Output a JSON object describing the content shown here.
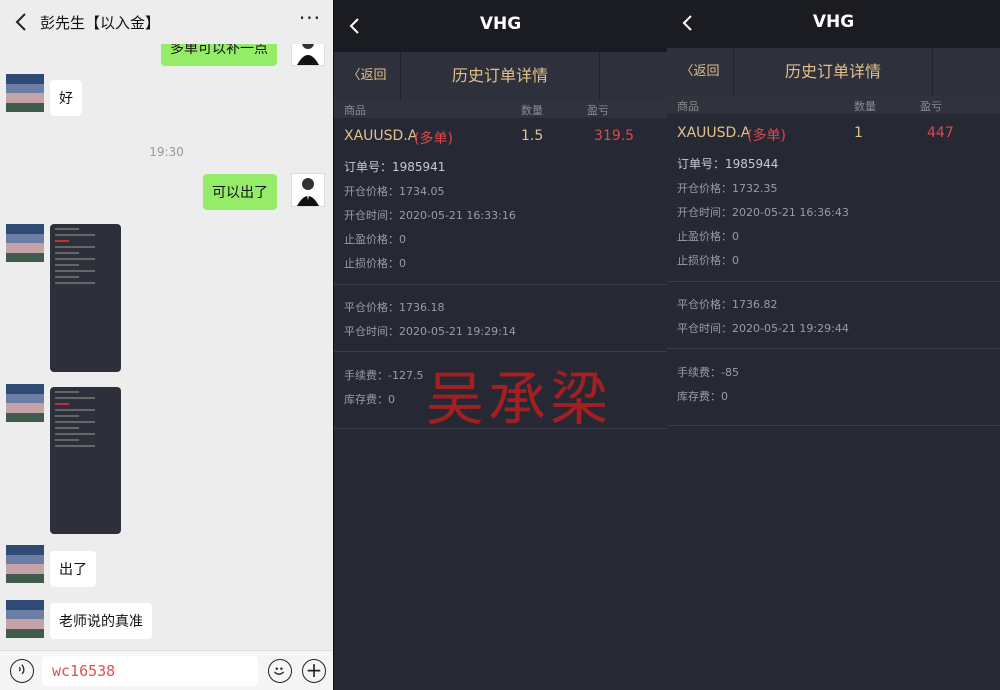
{
  "chat": {
    "title": "彭先生【以入金】",
    "more": "···",
    "partial_top_message": "多单可以补一点",
    "messages": {
      "ok": "好",
      "timestamp": "19:30",
      "can_close": "可以出了",
      "closed": "出了",
      "teacher_accurate": "老师说的真准"
    },
    "input_value": "wc16538",
    "plus": "+"
  },
  "panels": [
    {
      "app_title": "VHG",
      "back_label": "〈返回",
      "subtitle": "历史订单详情",
      "columns": {
        "product": "商品",
        "qty": "数量",
        "pnl": "盈亏"
      },
      "symbol": "XAUUSD.A",
      "side": "(多单)",
      "qty": "1.5",
      "pnl": "319.5",
      "order_no": "订单号：1985941",
      "open_price": "开仓价格：1734.05",
      "open_time": "开仓时间：2020-05-21 16:33:16",
      "take_profit": "止盈价格：0",
      "stop_loss": "止损价格：0",
      "close_price": "平仓价格：1736.18",
      "close_time": "平仓时间：2020-05-21 19:29:14",
      "fee": "手续费：-127.5",
      "swap": "库存费：0"
    },
    {
      "app_title": "VHG",
      "back_label": "〈返回",
      "subtitle": "历史订单详情",
      "columns": {
        "product": "商品",
        "qty": "数量",
        "pnl": "盈亏"
      },
      "symbol": "XAUUSD.A",
      "side": "(多单)",
      "qty": "1",
      "pnl": "447",
      "order_no": "订单号：1985944",
      "open_price": "开仓价格：1732.35",
      "open_time": "开仓时间：2020-05-21 16:36:43",
      "take_profit": "止盈价格：0",
      "stop_loss": "止损价格：0",
      "close_price": "平仓价格：1736.82",
      "close_time": "平仓时间：2020-05-21 19:29:44",
      "fee": "手续费：-85",
      "swap": "库存费：0"
    }
  ],
  "watermark": "吴承梁",
  "colors": {
    "chat_bg": "#ededed",
    "bubble_green": "#95ec69",
    "panel_bg": "#262833",
    "gold": "#e3c18c",
    "red": "#e04848"
  },
  "icons": [
    "back-arrow-icon",
    "more-dots-icon",
    "voice-icon",
    "emoji-icon",
    "plus-icon"
  ]
}
